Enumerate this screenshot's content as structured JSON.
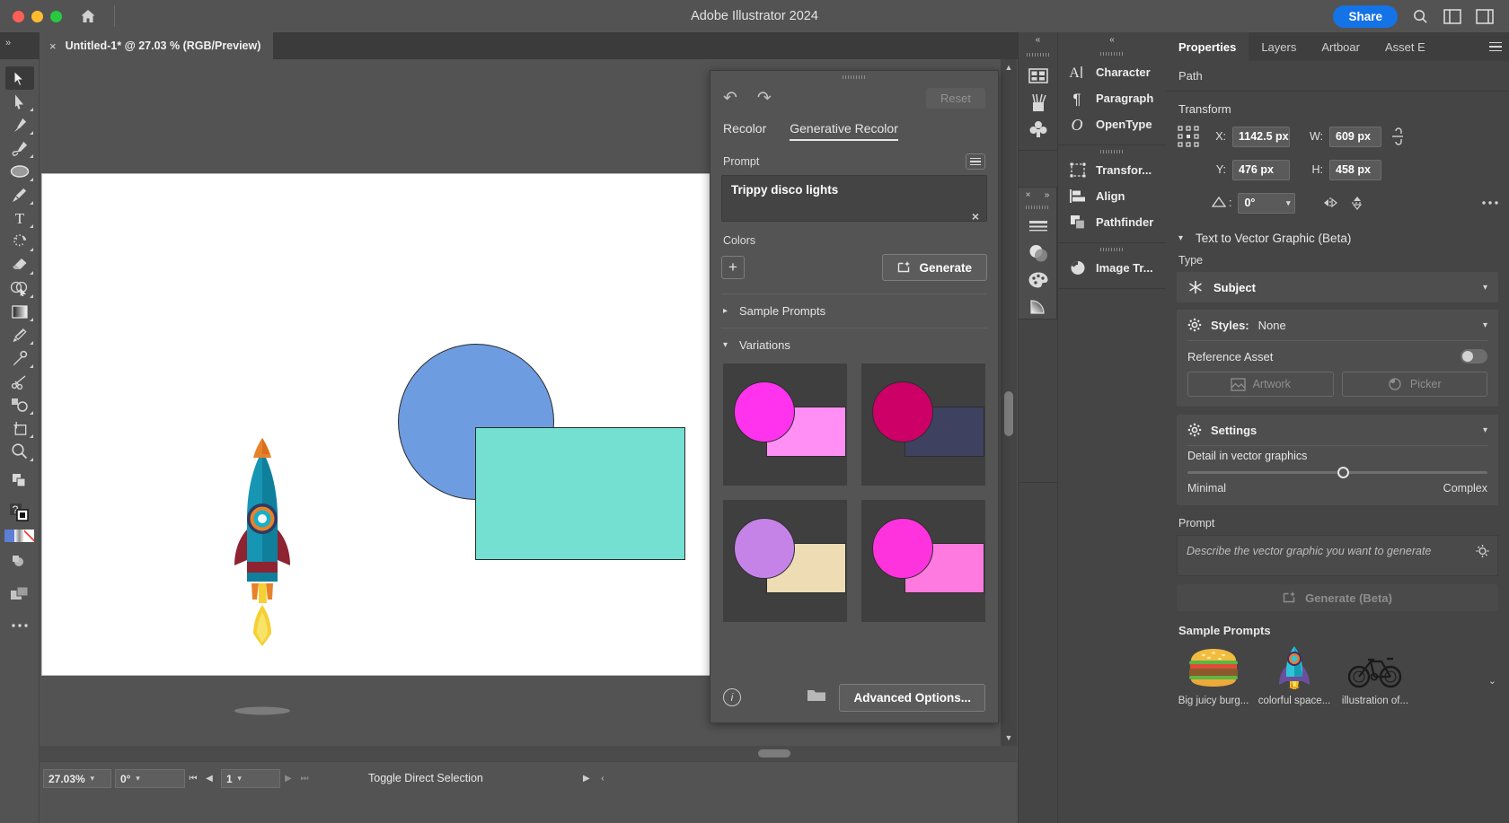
{
  "window": {
    "app_title": "Adobe Illustrator 2024",
    "share_label": "Share",
    "icons": {
      "home": "home-icon",
      "search": "search-icon",
      "panels": "panel-layout-icon",
      "arrange": "arrange-icon"
    }
  },
  "document_tab": {
    "title": "Untitled-1* @ 27.03 % (RGB/Preview)",
    "close": "×",
    "expander": "»"
  },
  "toolbar": {
    "tools": [
      {
        "name": "selection-tool",
        "has_corner": false,
        "active": true
      },
      {
        "name": "direct-selection-tool",
        "has_corner": true
      },
      {
        "name": "pen-tool",
        "has_corner": true
      },
      {
        "name": "curvature-tool",
        "has_corner": true
      },
      {
        "name": "ellipse-tool",
        "has_corner": true
      },
      {
        "name": "paintbrush-tool",
        "has_corner": true
      },
      {
        "name": "type-tool",
        "has_corner": true
      },
      {
        "name": "rotate-tool",
        "has_corner": true
      },
      {
        "name": "eraser-tool",
        "has_corner": true
      },
      {
        "name": "shape-builder-tool",
        "has_corner": true
      },
      {
        "name": "gradient-tool",
        "has_corner": true
      },
      {
        "name": "width-tool",
        "has_corner": true
      },
      {
        "name": "eyedropper-tool",
        "has_corner": true
      },
      {
        "name": "scissors-tool",
        "has_corner": false
      },
      {
        "name": "free-transform-tool",
        "has_corner": true
      },
      {
        "name": "artboard-tool",
        "has_corner": true
      },
      {
        "name": "zoom-tool",
        "has_corner": true
      },
      {
        "name": "edit-toolbar-button",
        "has_corner": false
      }
    ],
    "help_label": "?",
    "swatches": [
      "#5b7fd4",
      "#d8d8d8",
      "#ff3b30"
    ]
  },
  "canvas": {
    "shapes": [
      {
        "name": "blue-circle",
        "type": "circle",
        "fill": "#6d9de0",
        "stroke": "#2b2b2b"
      },
      {
        "name": "teal-rectangle",
        "type": "rect",
        "fill": "#74e0d2",
        "stroke": "#2b2b2b"
      },
      {
        "name": "rocket-artwork",
        "type": "artwork"
      }
    ]
  },
  "status_bar": {
    "zoom": "27.03%",
    "rotation": "0°",
    "artboard_number": "1",
    "tool_hint": "Toggle Direct Selection",
    "nav_first": "⏮",
    "nav_prev": "◀",
    "nav_next": "▶",
    "nav_last": "⏭",
    "play": "▶",
    "back": "‹"
  },
  "recolor_panel": {
    "reset_label": "Reset",
    "undo_icon": "undo-icon",
    "redo_icon": "redo-icon",
    "tabs": [
      {
        "label": "Recolor",
        "active": false
      },
      {
        "label": "Generative Recolor",
        "active": true
      }
    ],
    "prompt_label": "Prompt",
    "prompt_value": "Trippy disco lights",
    "prompt_clear": "×",
    "colors_label": "Colors",
    "add_color_label": "+",
    "generate_label": "Generate",
    "sample_prompts_label": "Sample Prompts",
    "variations_label": "Variations",
    "variations": [
      {
        "name": "variation-1",
        "circle": "#ff33ee",
        "rect": "#ff8ef5"
      },
      {
        "name": "variation-2",
        "circle": "#cc0066",
        "rect": "#3e4260"
      },
      {
        "name": "variation-3",
        "circle": "#c583e8",
        "rect": "#eddcb4"
      },
      {
        "name": "variation-4",
        "circle": "#ff33dd",
        "rect": "#ff7ae0"
      }
    ],
    "advanced_options_label": "Advanced Options...",
    "info_icon": "info-icon",
    "folder_icon": "folder-icon"
  },
  "icon_dock": {
    "collapse": "«",
    "groups": [
      [
        "swatches-icon",
        "brushes-icon",
        "symbols-icon"
      ],
      []
    ],
    "float": {
      "close": "×",
      "expand": "»",
      "icons": [
        "stroke-icon",
        "transparency-icon",
        "color-icon",
        "gradient-icon"
      ]
    }
  },
  "panel_dock": {
    "collapse": "«",
    "groups": [
      [
        {
          "label": "Character",
          "icon": "character-icon"
        },
        {
          "label": "Paragraph",
          "icon": "paragraph-icon"
        },
        {
          "label": "OpenType",
          "icon": "opentype-icon"
        }
      ],
      [
        {
          "label": "Transfor...",
          "icon": "transform-icon"
        },
        {
          "label": "Align",
          "icon": "align-icon"
        },
        {
          "label": "Pathfinder",
          "icon": "pathfinder-icon"
        }
      ],
      [
        {
          "label": "Image Tr...",
          "icon": "image-trace-icon"
        }
      ]
    ]
  },
  "properties": {
    "tabs": [
      {
        "label": "Properties",
        "active": true
      },
      {
        "label": "Layers",
        "active": false
      },
      {
        "label": "Artboar",
        "active": false
      },
      {
        "label": "Asset E",
        "active": false
      }
    ],
    "subtitle": "Path",
    "transform": {
      "title": "Transform",
      "x_label": "X:",
      "x_value": "1142.5 px",
      "y_label": "Y:",
      "y_value": "476 px",
      "w_label": "W:",
      "w_value": "609 px",
      "h_label": "H:",
      "h_value": "458 px",
      "angle_label": "△:",
      "angle_value": "0°",
      "link_icon": "link-broken-icon",
      "flip_h_icon": "flip-horizontal-icon",
      "flip_v_icon": "flip-vertical-icon",
      "more_icon": "more-options-icon",
      "anchor_icon": "reference-point-icon"
    },
    "tvg": {
      "title": "Text to Vector Graphic (Beta)",
      "type_label": "Type",
      "type_value": "Subject",
      "type_icon": "subject-icon",
      "styles_label": "Styles:",
      "styles_value": "None",
      "styles_icon": "gear-icon",
      "reference_asset_label": "Reference Asset",
      "reference_toggle": false,
      "artwork_label": "Artwork",
      "artwork_icon": "artwork-icon",
      "picker_label": "Picker",
      "picker_icon": "picker-icon",
      "settings_label": "Settings",
      "settings_icon": "gear-icon",
      "detail_label": "Detail in vector graphics",
      "detail_min": "Minimal",
      "detail_max": "Complex",
      "detail_percent": 50,
      "prompt_label": "Prompt",
      "prompt_placeholder": "Describe the vector graphic you want to generate",
      "prompt_value": "",
      "bulb_icon": "idea-icon",
      "generate_label": "Generate (Beta)",
      "generate_icon": "generate-icon",
      "sample_prompts_label": "Sample Prompts",
      "samples": [
        {
          "name": "burger-sample",
          "caption": "Big juicy burg..."
        },
        {
          "name": "rocket-sample",
          "caption": "colorful space..."
        },
        {
          "name": "bicycle-sample",
          "caption": "illustration of..."
        }
      ],
      "samples_chevron": "⌄"
    }
  },
  "colors": {
    "accent": "#1473e6",
    "panel_bg": "#454545",
    "toolbar_bg": "#535353",
    "field_bg": "#5a5a5a"
  }
}
